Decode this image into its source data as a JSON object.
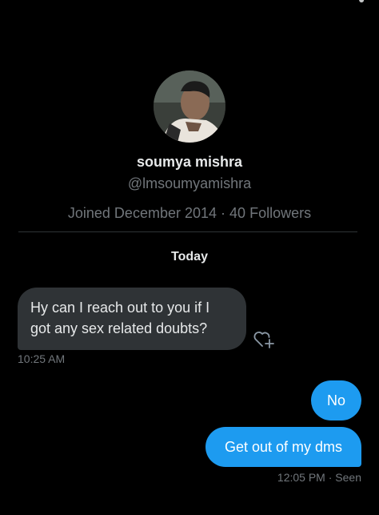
{
  "profile": {
    "name": "soumya mishra",
    "handle": "@lmsoumyamishra",
    "joined": "Joined December 2014",
    "separator": "·",
    "followers": "40 Followers"
  },
  "conversation": {
    "day_label": "Today",
    "messages": [
      {
        "direction": "incoming",
        "text": "Hy can I reach out to you if I got any sex related doubts?",
        "time": "10:25 AM"
      },
      {
        "direction": "outgoing",
        "text": "No"
      },
      {
        "direction": "outgoing",
        "text": "Get out of my dms",
        "time": "12:05 PM",
        "status": "Seen"
      }
    ]
  },
  "icons": {
    "react": "heart-plus-icon",
    "avatar": "profile-photo"
  },
  "colors": {
    "background": "#000000",
    "incoming_bubble": "#2f3336",
    "outgoing_bubble": "#1d9bf0",
    "muted_text": "#71767b"
  }
}
